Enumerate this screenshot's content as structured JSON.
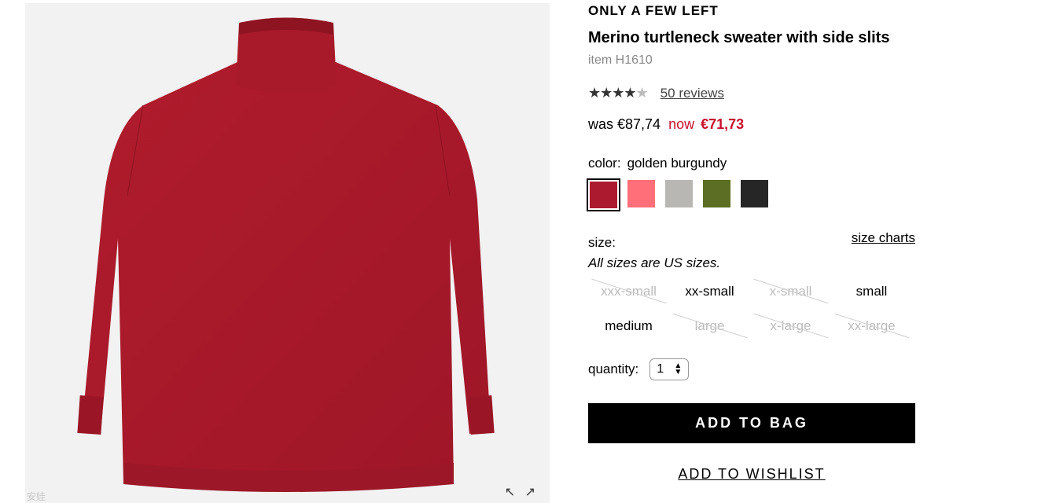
{
  "product": {
    "badge": "ONLY A FEW LEFT",
    "title": "Merino turtleneck sweater with side slits",
    "item_code": "item H1610",
    "rating": {
      "stars_full": "★★★★",
      "stars_partial": "★",
      "value": 4.5,
      "reviews_label": "50 reviews"
    },
    "price": {
      "was_label": "was €87,74",
      "now_label": "now",
      "now_value": "€71,73",
      "now_color": "#c8102e"
    }
  },
  "image": {
    "expand_icon_glyph": "↖ ↗",
    "watermark": "安娃"
  },
  "color": {
    "label": "color:",
    "selected": "golden burgundy",
    "swatches": [
      {
        "name": "golden burgundy",
        "hex": "#ab1a2e",
        "selected": true
      },
      {
        "name": "pink",
        "hex": "#ff6f7a",
        "selected": false
      },
      {
        "name": "grey",
        "hex": "#b9b7b4",
        "selected": false
      },
      {
        "name": "olive",
        "hex": "#5b6e23",
        "selected": false
      },
      {
        "name": "black",
        "hex": "#262626",
        "selected": false
      }
    ]
  },
  "size": {
    "label": "size:",
    "charts_link": "size charts",
    "note": "All sizes are US sizes.",
    "options": [
      {
        "label": "xxx-small",
        "available": false
      },
      {
        "label": "xx-small",
        "available": true
      },
      {
        "label": "x-small",
        "available": false
      },
      {
        "label": "small",
        "available": true
      },
      {
        "label": "medium",
        "available": true
      },
      {
        "label": "large",
        "available": false
      },
      {
        "label": "x-large",
        "available": false
      },
      {
        "label": "xx-large",
        "available": false
      }
    ]
  },
  "quantity": {
    "label": "quantity:",
    "value": "1"
  },
  "actions": {
    "add_to_bag": "ADD TO BAG",
    "add_to_wishlist": "ADD TO WISHLIST"
  }
}
